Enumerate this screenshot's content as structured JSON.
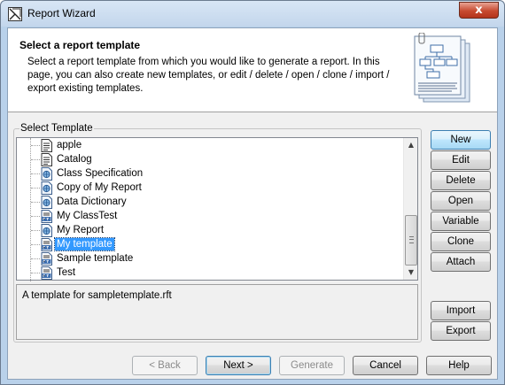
{
  "window": {
    "title": "Report Wizard",
    "close_glyph": "x"
  },
  "header": {
    "title": "Select a report template",
    "description": "Select a report template from which you would like to generate a report. In this page, you can also create new templates, or edit / delete / open / clone / import / export existing templates."
  },
  "template_group": {
    "label": "Select Template",
    "items": [
      {
        "label": "apple",
        "icon": "document-icon"
      },
      {
        "label": "Catalog",
        "icon": "document-icon"
      },
      {
        "label": "Class Specification",
        "icon": "html-template-icon"
      },
      {
        "label": "Copy of My Report",
        "icon": "html-template-icon"
      },
      {
        "label": "Data Dictionary",
        "icon": "html-template-icon"
      },
      {
        "label": "My ClassTest",
        "icon": "rtf-template-icon"
      },
      {
        "label": "My Report",
        "icon": "html-template-icon"
      },
      {
        "label": "My template",
        "icon": "rtf-template-icon",
        "selected": true
      },
      {
        "label": "Sample template",
        "icon": "rtf-template-icon"
      },
      {
        "label": "Test",
        "icon": "rtf-template-icon"
      }
    ],
    "description": "A template for sampletemplate.rft"
  },
  "side_buttons": {
    "new": "New",
    "edit": "Edit",
    "delete": "Delete",
    "open": "Open",
    "variable": "Variable",
    "clone": "Clone",
    "attach": "Attach",
    "import": "Import",
    "export": "Export"
  },
  "footer": {
    "back": "< Back",
    "next": "Next >",
    "generate": "Generate",
    "cancel": "Cancel",
    "help": "Help"
  },
  "colors": {
    "selection": "#3399ff",
    "window_frame": "#b9d1ea",
    "close_button": "#c74a30"
  }
}
